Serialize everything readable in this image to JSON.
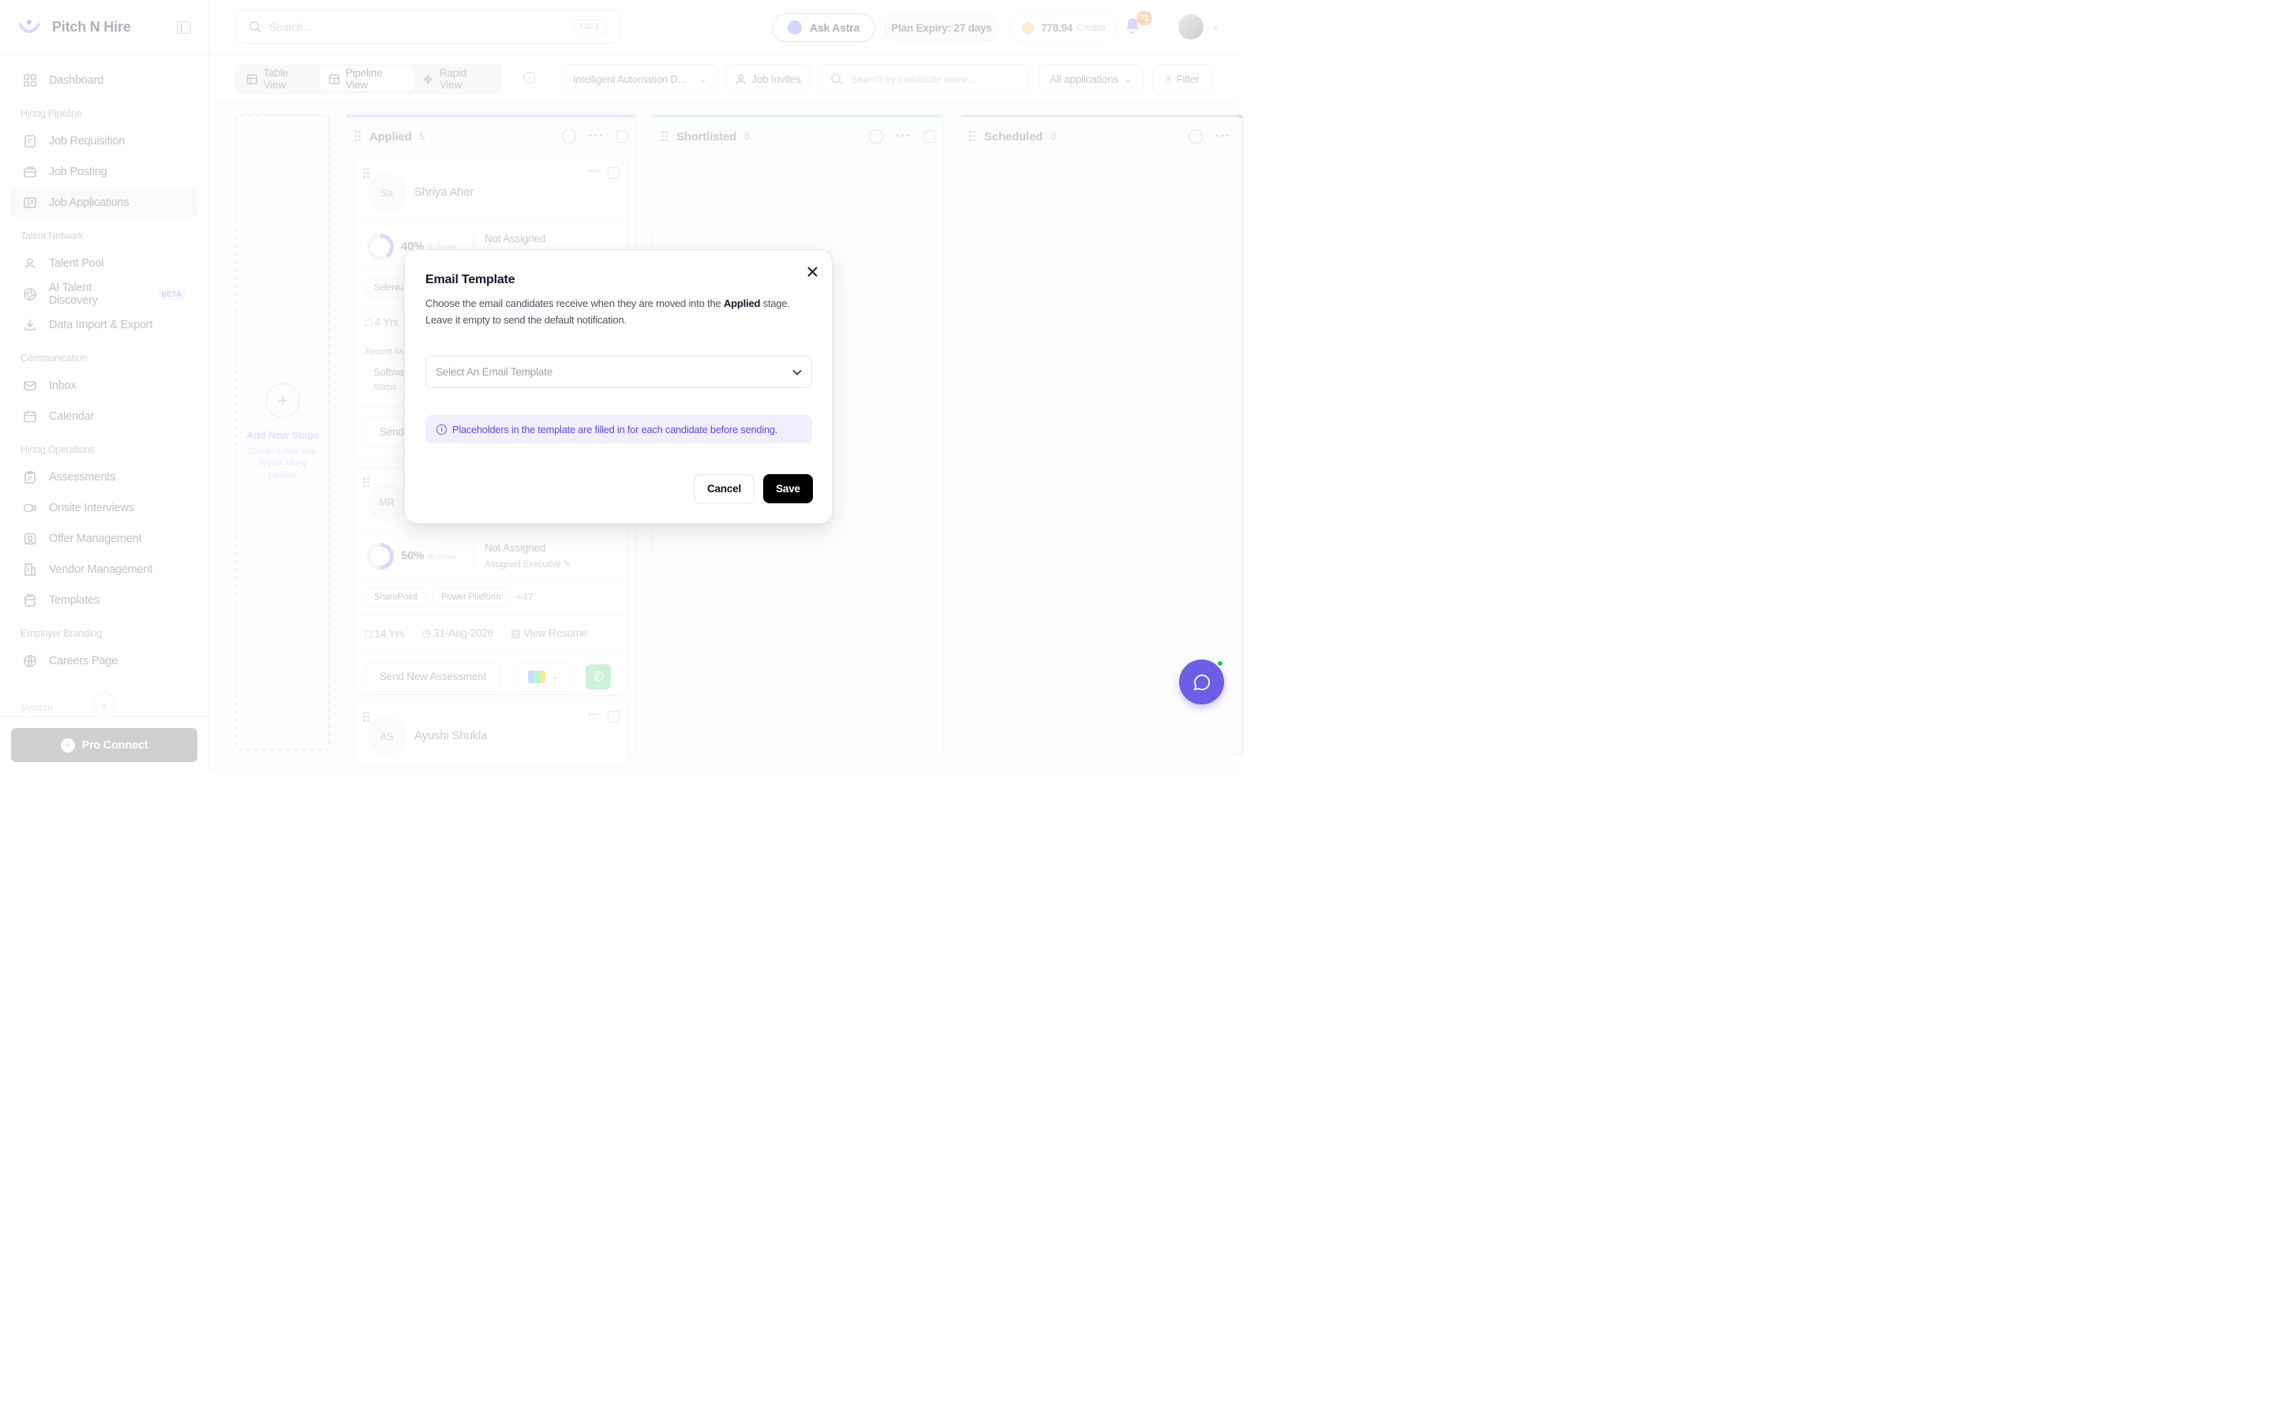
{
  "brand": {
    "name": "Pitch N Hire"
  },
  "sidebar": {
    "dashboard": "Dashboard",
    "sections": {
      "hiring_pipeline": "Hiring Pipeline",
      "talent_network": "Talent Network",
      "communication": "Communication",
      "hiring_operations": "Hiring Operations",
      "employer_branding": "Employer Branding",
      "system": "System"
    },
    "items": {
      "job_requisition": "Job Requisition",
      "job_posting": "Job Posting",
      "job_applications": "Job Applications",
      "talent_pool": "Talent Pool",
      "ai_talent_discovery": "AI Talent Discovery",
      "beta": "BETA",
      "data_import_export": "Data Import & Export",
      "inbox": "Inbox",
      "calendar": "Calendar",
      "assessments": "Assessments",
      "onsite_interviews": "Onsite Interviews",
      "offer_management": "Offer Management",
      "vendor_management": "Vendor Management",
      "templates": "Templates",
      "careers_page": "Careers Page"
    },
    "pro_connect": "Pro Connect"
  },
  "header": {
    "search_placeholder": "Search...",
    "search_shortcut": "Ctrl K",
    "ask_astra": "Ask Astra",
    "plan_expiry": "Plan Expiry: 27 days",
    "credits_value": "778.94",
    "credits_label": "Credits",
    "notifications_count": "71"
  },
  "toolbar": {
    "table_view": "Table View",
    "pipeline_view": "Pipeline View",
    "rapid_view": "Rapid View",
    "job_select": "Intelligent Automation D...",
    "job_invites": "Job Invites",
    "candidate_search_placeholder": "Search by candidate name...",
    "applications_filter": "All applications",
    "filter": "Filter"
  },
  "board": {
    "add_stage": {
      "title": "Add New Stage",
      "subtitle": "Create a new step in your hiring pipeline"
    },
    "columns": [
      {
        "title": "Applied",
        "count": "5"
      },
      {
        "title": "Shortlisted",
        "count": "0"
      },
      {
        "title": "Scheduled",
        "count": "0"
      }
    ],
    "cards": [
      {
        "initials": "Sa",
        "name": "Shriya Aher",
        "score": "40%",
        "score_label": "Ai Score",
        "assigned": "Not Assigned",
        "skill": "Seleniu",
        "experience": "4 Yrs",
        "recent_label": "Recent As",
        "recent_value": "Softwa",
        "status_label": "Status :",
        "action": "Send"
      },
      {
        "initials": "MR",
        "score": "50%",
        "score_label": "Ai Score",
        "assigned": "Not Assigned",
        "assigned_sub": "Assigned Executive",
        "skills": [
          "SharePoint",
          "Power Platform"
        ],
        "more": "+47",
        "experience": "14 Yrs",
        "date": "31-Aug-2026",
        "resume": "View Resume",
        "action": "Send New Assessment"
      },
      {
        "initials": "AS",
        "name": "Ayushi Shukla"
      }
    ]
  },
  "modal": {
    "title": "Email Template",
    "desc_prefix": "Choose the email candidates receive when they are moved into the",
    "desc_stage": "Applied",
    "desc_suffix": "stage.",
    "desc_line2": "Leave it empty to send the default notification.",
    "select_placeholder": "Select An Email Template",
    "notice": "Placeholders in the template are filled in for each candidate before sending.",
    "cancel": "Cancel",
    "save": "Save"
  },
  "colors": {
    "accent": "#6d5ee8",
    "save_button": "#000000",
    "notice_bg": "#f1eefe"
  }
}
